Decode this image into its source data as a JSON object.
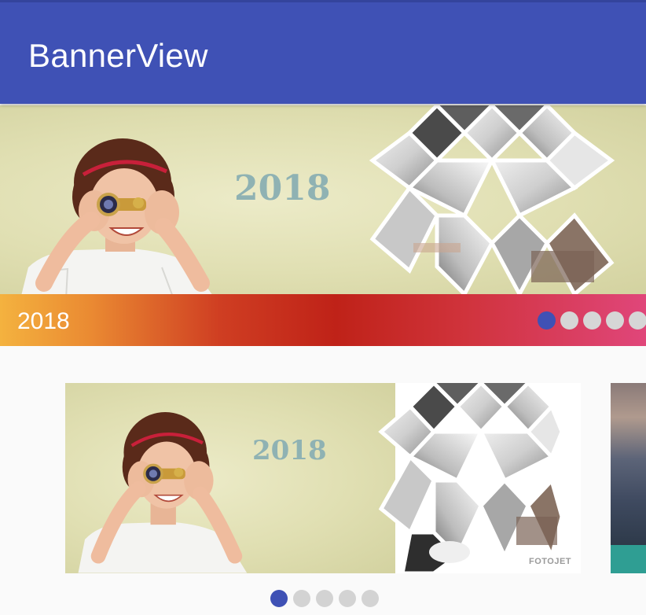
{
  "app": {
    "title": "BannerView"
  },
  "banner_top": {
    "image_year_text": "2018",
    "caption": "2018",
    "indicator_count": 5,
    "active_index": 0,
    "caption_gradient": [
      "#f4b23f",
      "#bf2218",
      "#e0467a"
    ]
  },
  "banner_card": {
    "image_year_text": "2018",
    "watermark": "FOTOJET",
    "indicator_count": 5,
    "active_index": 0
  },
  "colors": {
    "primary": "#3f51b5",
    "indicator_inactive": "#d6d6d6",
    "background": "#fafafa"
  }
}
